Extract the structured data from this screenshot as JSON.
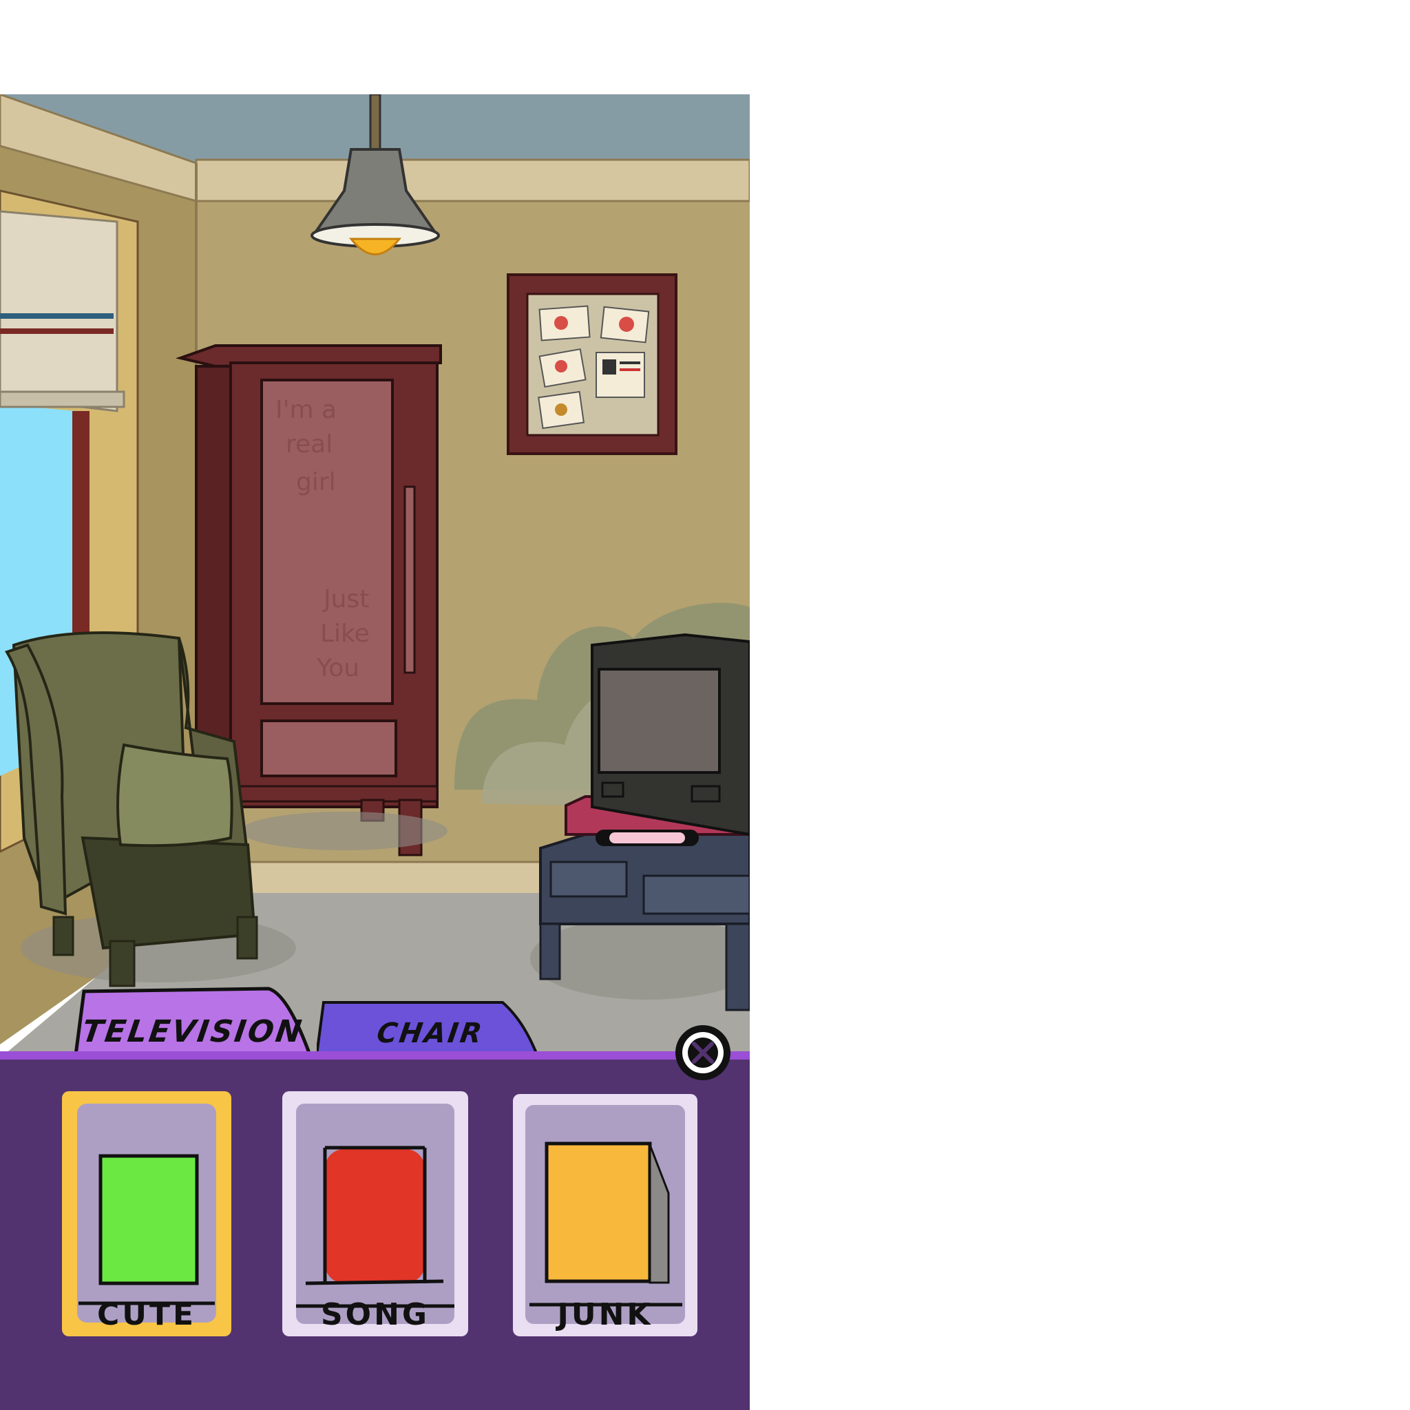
{
  "window": {
    "background": "#ffffff"
  },
  "tabs": [
    {
      "label": "TELEVISION",
      "color": "#b873e6",
      "active": true
    },
    {
      "label": "CHAIR",
      "color": "#6b52d9",
      "active": false
    }
  ],
  "close_button": {
    "icon": "close-x-icon"
  },
  "cards": [
    {
      "label": "CUTE",
      "swatch_color": "#6ce843",
      "selected": true
    },
    {
      "label": "SONG",
      "swatch_color": "#e13527",
      "selected": false
    },
    {
      "label": "JUNK",
      "swatch_color": "#f7b83c",
      "selected": false
    }
  ],
  "colors": {
    "panel": "#523370",
    "card_bg": "#ad9fc4",
    "card_border": "#e9def2",
    "selected_border": "#f9c546",
    "wall": "#b5a271",
    "ceiling": "#869ca5",
    "floor": "#a8a7a1",
    "sky": "#8ce0fa"
  }
}
